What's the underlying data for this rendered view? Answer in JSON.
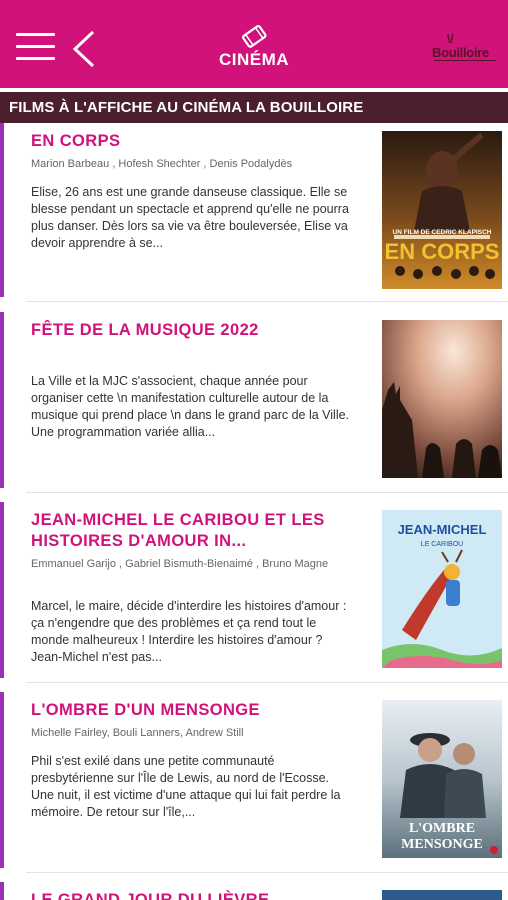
{
  "header": {
    "title": "CINÉMA",
    "logo_text": "Bouilloire"
  },
  "section": {
    "title": "FILMS À L'AFFICHE AU CINÉMA LA BOUILLOIRE"
  },
  "films": [
    {
      "title": "EN CORPS",
      "cast": "Marion Barbeau , Hofesh Shechter , Denis Podalydès",
      "description": "Elise, 26 ans est une grande danseuse classique. Elle se blesse pendant un spectacle et apprend qu'elle ne pourra plus danser. Dès lors sa vie va être bouleversée, Elise va devoir apprendre à se...",
      "poster_line1": "UN FILM DE CEDRIC KLAPISCH",
      "poster_line2": "EN CORPS"
    },
    {
      "title": "FÊTE DE LA MUSIQUE 2022",
      "cast": "",
      "description": "La Ville et la MJC s'associent, chaque année pour organiser cette \\n manifestation culturelle autour de la musique qui prend place \\n dans le grand parc de la Ville. Une programmation variée allia..."
    },
    {
      "title": "JEAN-MICHEL LE CARIBOU ET LES HISTOIRES D'AMOUR IN...",
      "cast": "Emmanuel Garijo , Gabriel Bismuth-Bienaimé , Bruno Magne",
      "description": "Marcel, le maire, décide d'interdire les histoires d'amour : ça n'engendre que des problèmes et ça rend tout le monde malheureux ! Interdire les histoires d'amour ? Jean-Michel n'est pas...",
      "poster_line1": "JEAN-MICHEL",
      "poster_line2": "LE CARIBOU"
    },
    {
      "title": "L'OMBRE D'UN MENSONGE",
      "cast": "Michelle Fairley, Bouli Lanners, Andrew Still",
      "description": "Phil s'est exilé dans une petite communauté presbytérienne sur l'Île de Lewis, au nord de l'Ecosse. Une nuit, il est victime d'une attaque qui lui fait perdre la mémoire. De retour sur l'île,...",
      "poster_line1": "L'OMBRE",
      "poster_line2": "MENSONGE"
    },
    {
      "title": "LE GRAND JOUR DU LIÈVRE"
    }
  ]
}
